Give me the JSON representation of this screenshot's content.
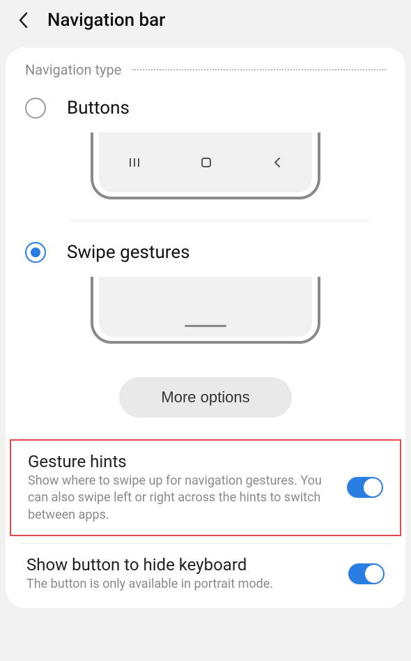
{
  "header": {
    "title": "Navigation bar"
  },
  "section": {
    "label": "Navigation type"
  },
  "options": {
    "buttons": {
      "label": "Buttons",
      "selected": false
    },
    "swipe": {
      "label": "Swipe gestures",
      "selected": true
    }
  },
  "more_options": {
    "label": "More options"
  },
  "settings": {
    "gesture_hints": {
      "title": "Gesture hints",
      "desc": "Show where to swipe up for navigation gestures. You can also swipe left or right across the hints to switch between apps.",
      "enabled": true,
      "highlighted": true
    },
    "hide_keyboard": {
      "title": "Show button to hide keyboard",
      "desc": "The button is only available in portrait mode.",
      "enabled": true
    }
  }
}
